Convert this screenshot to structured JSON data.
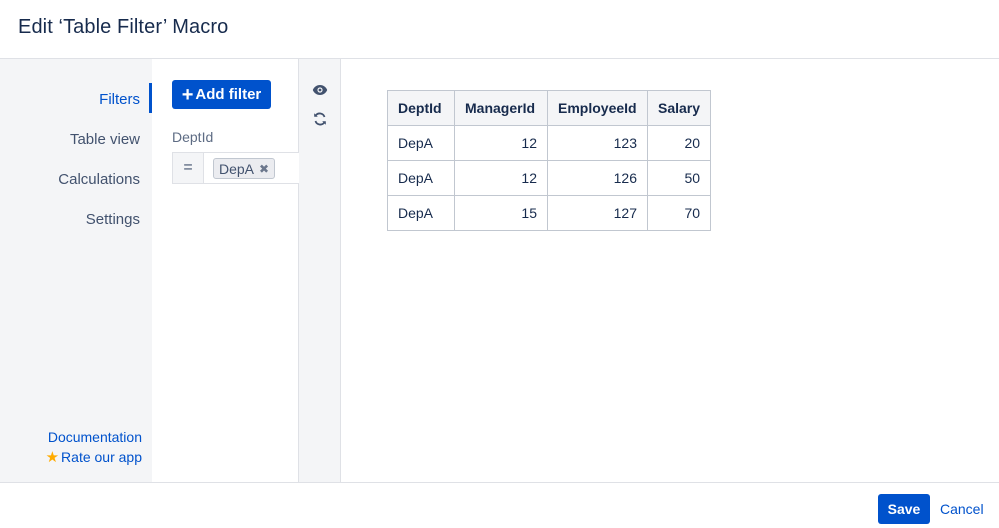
{
  "dialog": {
    "title": "Edit ‘Table Filter’ Macro"
  },
  "nav": {
    "items": [
      {
        "label": "Filters",
        "active": true
      },
      {
        "label": "Table view",
        "active": false
      },
      {
        "label": "Calculations",
        "active": false
      },
      {
        "label": "Settings",
        "active": false
      }
    ],
    "links": {
      "documentation": "Documentation",
      "rate": "Rate our app"
    }
  },
  "filters": {
    "add_button": "Add filter",
    "field_label": "DeptId",
    "operator": "=",
    "selected_value": "DepA"
  },
  "tools": {
    "icons": [
      "eye-icon",
      "refresh-icon"
    ]
  },
  "table": {
    "headers": [
      "DeptId",
      "ManagerId",
      "EmployeeId",
      "Salary"
    ],
    "rows": [
      [
        "DepA",
        "12",
        "123",
        "20"
      ],
      [
        "DepA",
        "12",
        "126",
        "50"
      ],
      [
        "DepA",
        "15",
        "127",
        "70"
      ]
    ]
  },
  "footer": {
    "save_label": "Save",
    "cancel_label": "Cancel"
  },
  "colors": {
    "accent": "#0052cc",
    "nav_bg": "#f4f5f7",
    "star": "#ffab00"
  }
}
